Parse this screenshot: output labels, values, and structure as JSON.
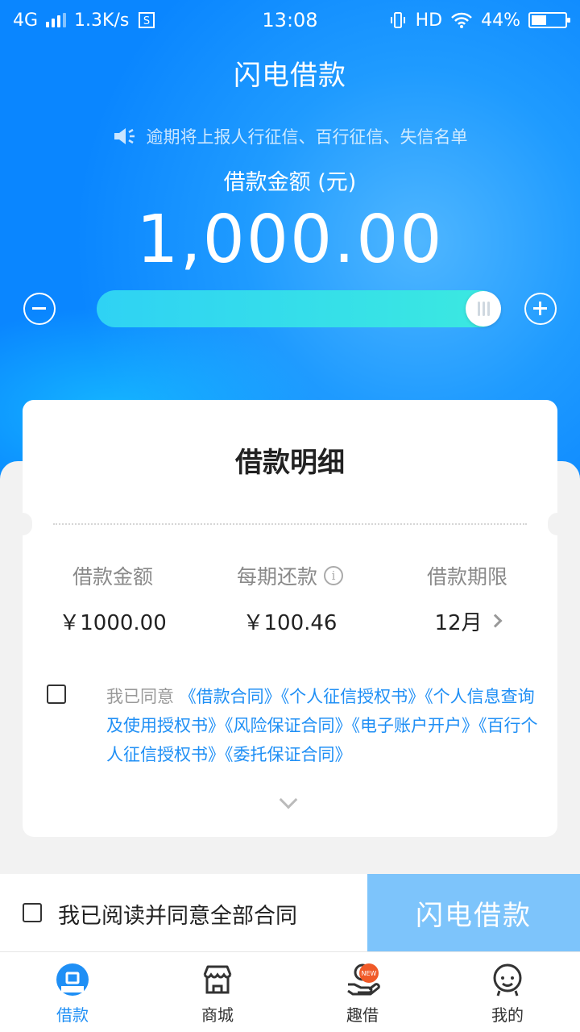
{
  "status_bar": {
    "network": "4G",
    "speed": "1.3K/s",
    "time": "13:08",
    "hd": "HD",
    "battery": "44%",
    "battery_level": 0.44
  },
  "header": {
    "title": "闪电借款"
  },
  "notice": {
    "text": "逾期将上报人行征信、百行征信、失信名单"
  },
  "loan": {
    "amount_label": "借款金额 (元)",
    "amount": "1,000.00",
    "slider_fraction": 1.0
  },
  "detail_card": {
    "title": "借款明细",
    "columns": [
      {
        "label": "借款金额",
        "value": "￥1000.00"
      },
      {
        "label": "每期还款",
        "value": "￥100.46"
      },
      {
        "label": "借款期限",
        "value": "12月"
      }
    ],
    "info_icon": "i",
    "agreement_prefix": "我已同意",
    "contracts": [
      "《借款合同》",
      "《个人征信授权书》",
      "《个人信息查询及使用授权书》",
      "《风险保证合同》",
      "《电子账户开户》",
      "《百行个人征信授权书》",
      "《委托保证合同》"
    ]
  },
  "action_bar": {
    "agree_all": "我已阅读并同意全部合同",
    "submit": "闪电借款"
  },
  "tabbar": {
    "items": [
      {
        "label": "借款",
        "icon": "loan-icon",
        "active": true
      },
      {
        "label": "商城",
        "icon": "store-icon",
        "active": false
      },
      {
        "label": "趣借",
        "icon": "hand-coin-icon",
        "active": false
      },
      {
        "label": "我的",
        "icon": "profile-icon",
        "active": false
      }
    ],
    "new_badge": "NEW"
  },
  "colors": {
    "brand_blue": "#1f8ff5",
    "submit_disabled": "#7dc4fb",
    "slider_track": "#2fd2f4"
  }
}
